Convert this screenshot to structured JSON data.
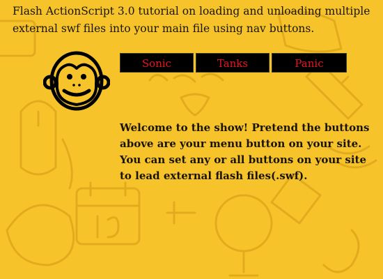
{
  "page": {
    "title": "Flash ActionScript 3.0 tutorial on loading and unloading multiple external swf files into your main file using nav buttons.",
    "welcome": "Welcome to the show! Pretend the buttons above are your menu button on your site. You can set any or all buttons on your site to lead external flash files(.swf)."
  },
  "nav": {
    "buttons": [
      {
        "label": "Sonic"
      },
      {
        "label": "Tanks"
      },
      {
        "label": "Panic"
      }
    ]
  },
  "icons": {
    "logo": "monkey-face-icon"
  },
  "colors": {
    "background": "#f6c42a",
    "button_bg": "#000000",
    "button_text": "#e8141c",
    "text": "#1a1406"
  }
}
